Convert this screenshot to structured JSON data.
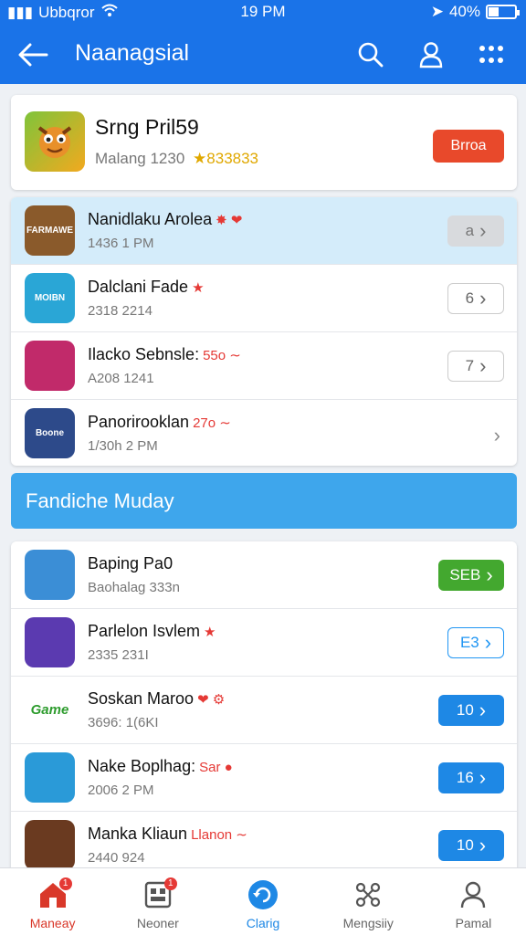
{
  "status": {
    "carrier": "Ubbqror",
    "time": "19 PM",
    "battery": "40%",
    "battery_level": 0.4
  },
  "appbar": {
    "title": "Naanagsial",
    "actions": [
      "search-icon",
      "profile-icon",
      "menu-grid-icon"
    ]
  },
  "featured": {
    "name": "Srng Pril59",
    "sub": "Malang 1230",
    "stars": "★833833",
    "button": "Brroa"
  },
  "list1": [
    {
      "name": "Nanidlaku Arolea",
      "extra": "✸ ❤",
      "sub": "1436 1 PM",
      "button": "a",
      "icon_text": "FARMAWE",
      "icon_color": "#8a5a2b"
    },
    {
      "name": "Dalclani Fade",
      "extra": "★",
      "sub": "2318 2214",
      "button": "6",
      "icon_text": "MOIBN",
      "icon_color": "#2aa6d6"
    },
    {
      "name": "Ilacko Sebnsle:",
      "extra": "55o ∼",
      "sub": "A208 1241",
      "button": "7",
      "icon_text": "",
      "icon_color": "#c12a6a"
    },
    {
      "name": "Panorirooklan",
      "extra": "27o ∼",
      "sub": "1/30h 2 PM",
      "button": "",
      "icon_text": "Boone",
      "icon_color": "#2d4a8a"
    }
  ],
  "banner": "Fandiche Muday",
  "list2": [
    {
      "name": "Baping Pa0",
      "extra": "",
      "sub": "Baohalag 333n",
      "button": "SEB",
      "icon_text": "",
      "icon_color": "#3b8ed6"
    },
    {
      "name": "Parlelon Isvlem",
      "extra": "★",
      "sub": "2335 231I",
      "button": "E3",
      "icon_text": "",
      "icon_color": "#5b3ab0"
    },
    {
      "name": "Soskan Maroo",
      "extra": "❤ ⚙",
      "sub": "3696: 1(6KI",
      "button": "10",
      "icon_text": "Game",
      "icon_color": "#ffffff"
    },
    {
      "name": "Nake Boplhag:",
      "extra": "Sar ●",
      "sub": "2006 2 PM",
      "button": "16",
      "icon_text": "",
      "icon_color": "#2a9ad8"
    },
    {
      "name": "Manka Kliaun",
      "extra": "Llanon ∼",
      "sub": "2440 924",
      "button": "10",
      "icon_text": "",
      "icon_color": "#6a3a20"
    }
  ],
  "nav": [
    {
      "label": "Maneay",
      "badge": "1"
    },
    {
      "label": "Neoner",
      "badge": "1"
    },
    {
      "label": "Clarig",
      "badge": ""
    },
    {
      "label": "Mengsiiy",
      "badge": ""
    },
    {
      "label": "Pamal",
      "badge": ""
    }
  ],
  "colors": {
    "brand": "#1a73e8",
    "featured_button": "#e8492b",
    "banner": "#3ea6ec",
    "green_button": "#43a82f",
    "blue_button": "#1e88e5"
  }
}
